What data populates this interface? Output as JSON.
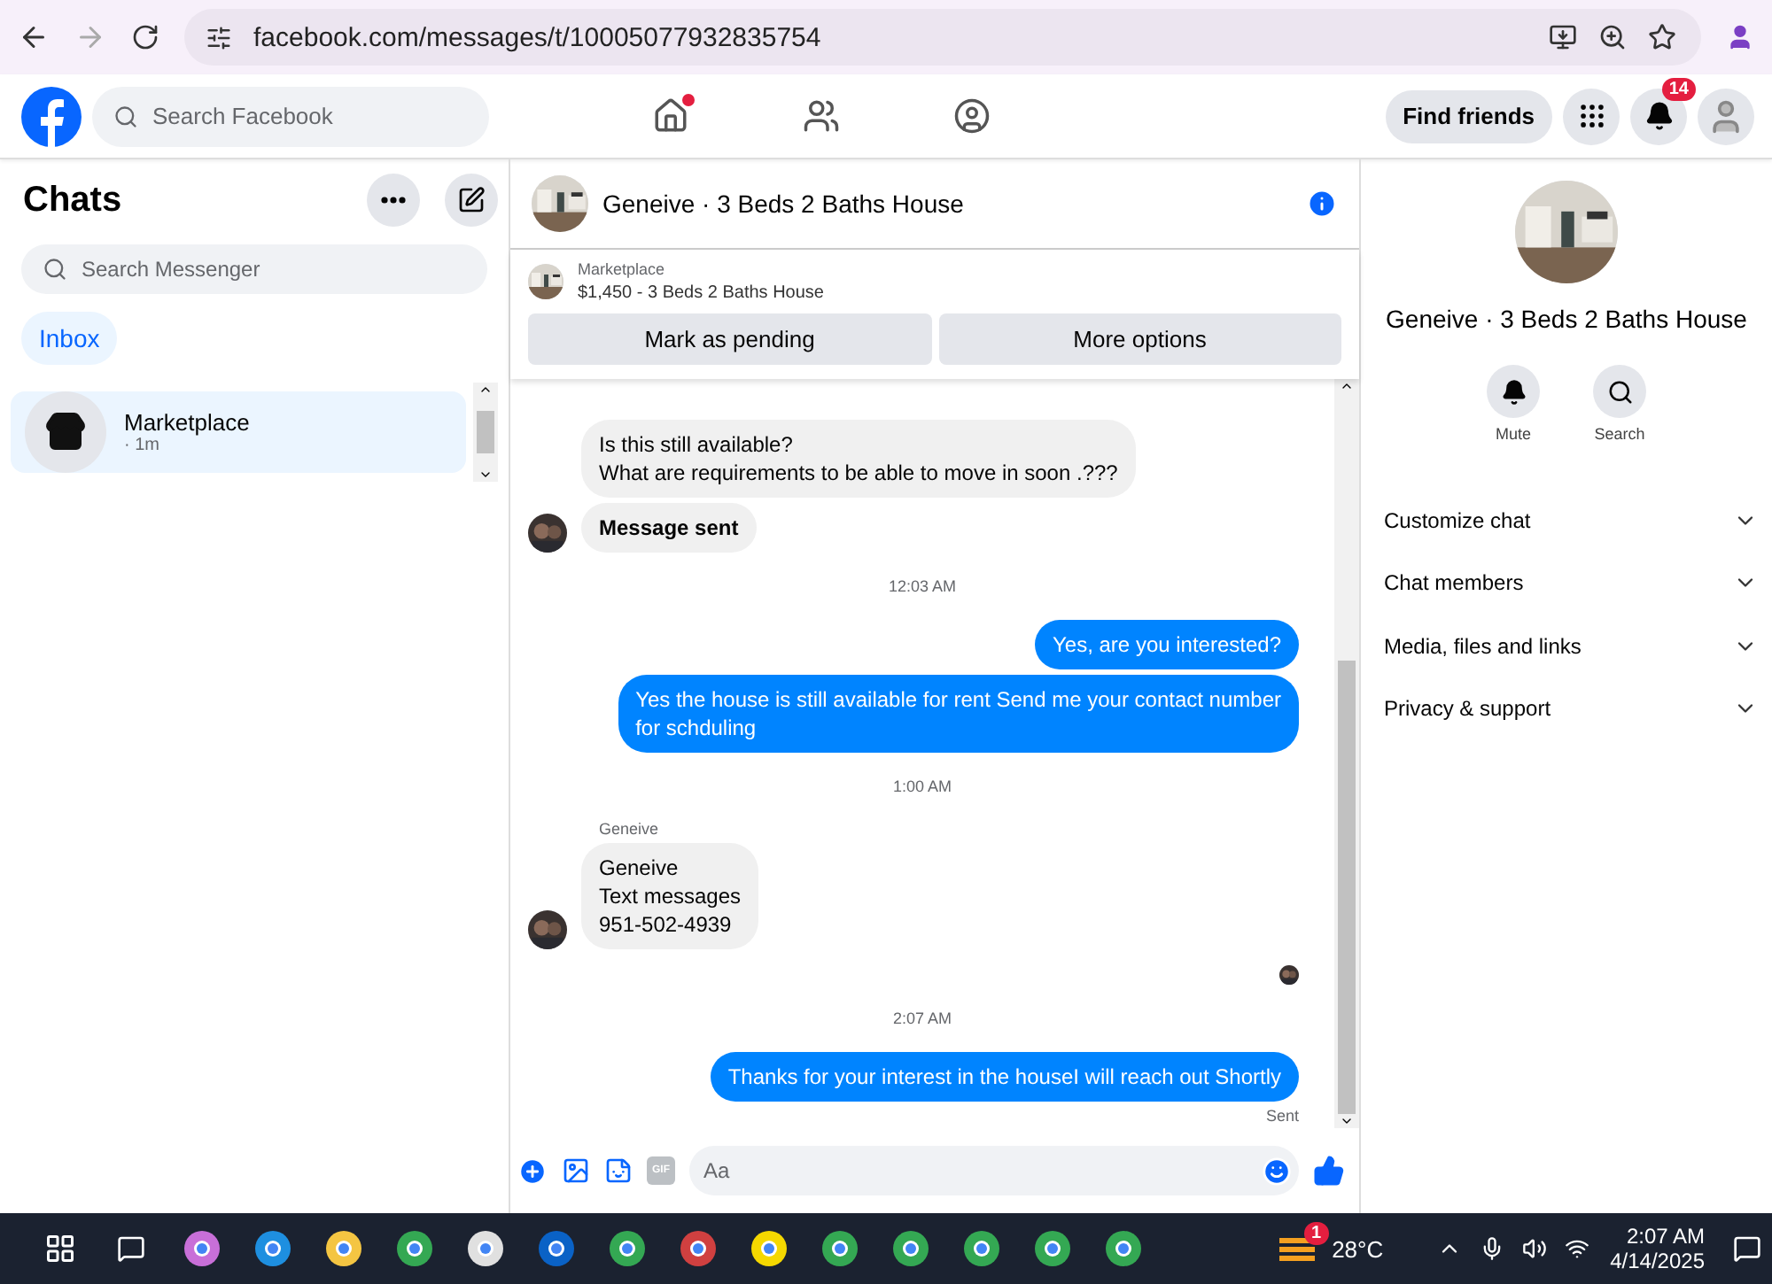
{
  "browser": {
    "url": "facebook.com/messages/t/10005077932835754"
  },
  "header": {
    "search_placeholder": "Search Facebook",
    "nav": [
      {
        "kind": "home",
        "selected": false,
        "dot": true
      },
      {
        "kind": "friends",
        "selected": false,
        "dot": false
      },
      {
        "kind": "groups",
        "selected": false,
        "dot": false
      }
    ],
    "find_friends": "Find friends",
    "notifications": "14"
  },
  "chats": {
    "title": "Chats",
    "search_placeholder": "Search Messenger",
    "filters": [
      {
        "label": "Inbox",
        "selected": true
      }
    ],
    "items": [
      {
        "name": "Marketplace",
        "time": "· 1m",
        "selected": true
      }
    ]
  },
  "conversation": {
    "title": "Geneive · 3 Beds 2 Baths House",
    "listing": {
      "source": "Marketplace",
      "title": "$1,450 - 3 Beds 2 Baths House",
      "actions": [
        "Mark as pending",
        "More options"
      ]
    },
    "messages": [
      {
        "kind": "incoming",
        "lines": [
          "Is this still available?",
          "What are requirements to be able to move in soon .???"
        ],
        "avatar": false,
        "bold": false
      },
      {
        "kind": "incoming",
        "lines": [
          "Message sent"
        ],
        "avatar": true,
        "bold": true
      },
      {
        "kind": "time",
        "text": "12:03 AM"
      },
      {
        "kind": "outgoing",
        "lines": [
          "Yes, are you interested?"
        ]
      },
      {
        "kind": "outgoing",
        "lines": [
          "Yes the house is still available for rent Send me your contact number",
          "for schduling"
        ]
      },
      {
        "kind": "time",
        "text": "1:00 AM"
      },
      {
        "kind": "sender",
        "text": "Geneive"
      },
      {
        "kind": "incoming",
        "lines": [
          "Geneive",
          "Text messages",
          "951-502-4939"
        ],
        "avatar": true,
        "bold": false
      },
      {
        "kind": "seen"
      },
      {
        "kind": "time",
        "text": "2:07 AM"
      },
      {
        "kind": "outgoing",
        "lines": [
          "Thanks for your interest in the houseI will reach out Shortly"
        ]
      },
      {
        "kind": "status",
        "text": "Sent"
      }
    ],
    "composer": {
      "gif": "GIF",
      "placeholder": "Aa"
    }
  },
  "details": {
    "title": "Geneive · 3 Beds 2 Baths House",
    "actions": [
      {
        "kind": "mute",
        "label": "Mute"
      },
      {
        "kind": "search",
        "label": "Search"
      }
    ],
    "sections": [
      {
        "label": "Customize chat",
        "expanded": false
      },
      {
        "label": "Chat members",
        "expanded": false
      },
      {
        "label": "Media, files and links",
        "expanded": false
      },
      {
        "label": "Privacy & support",
        "expanded": false
      }
    ]
  },
  "taskbar": {
    "weather": {
      "temp": "28°C",
      "badge": "1"
    },
    "time": "2:07 AM",
    "date": "4/14/2025"
  }
}
